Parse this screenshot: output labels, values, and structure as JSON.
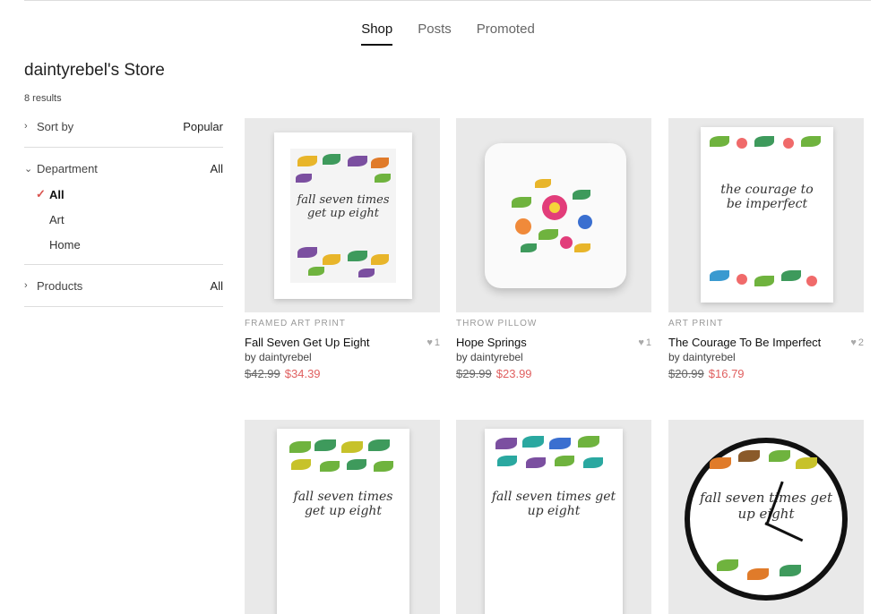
{
  "tabs": [
    {
      "label": "Shop",
      "active": true
    },
    {
      "label": "Posts",
      "active": false
    },
    {
      "label": "Promoted",
      "active": false
    }
  ],
  "store": {
    "title": "daintyrebel's Store",
    "results": "8 results"
  },
  "filters": {
    "sort": {
      "label": "Sort by",
      "value": "Popular"
    },
    "department": {
      "label": "Department",
      "value": "All",
      "options": [
        "All",
        "Art",
        "Home"
      ],
      "selected": "All"
    },
    "products": {
      "label": "Products",
      "value": "All"
    }
  },
  "products": [
    {
      "type": "Framed Art Print",
      "name": "Fall Seven Get Up Eight",
      "by": "by daintyrebel",
      "old_price": "$42.99",
      "price": "$34.39",
      "likes": "1",
      "art_text": "fall seven times get up eight"
    },
    {
      "type": "Throw Pillow",
      "name": "Hope Springs",
      "by": "by daintyrebel",
      "old_price": "$29.99",
      "price": "$23.99",
      "likes": "1",
      "art_text": ""
    },
    {
      "type": "Art Print",
      "name": "The Courage To Be Imperfect",
      "by": "by daintyrebel",
      "old_price": "$20.99",
      "price": "$16.79",
      "likes": "2",
      "art_text": "the courage to be imperfect"
    },
    {
      "type": "",
      "name": "",
      "by": "",
      "old_price": "",
      "price": "",
      "likes": "",
      "art_text": "fall seven times get up eight"
    },
    {
      "type": "",
      "name": "",
      "by": "",
      "old_price": "",
      "price": "",
      "likes": "",
      "art_text": "fall seven times get up eight"
    },
    {
      "type": "",
      "name": "",
      "by": "",
      "old_price": "",
      "price": "",
      "likes": "",
      "art_text": "fall seven times get up eight"
    }
  ],
  "colors": {
    "accent": "#e06060",
    "check": "#d9534f",
    "thumb_bg": "#e9e9e9"
  }
}
